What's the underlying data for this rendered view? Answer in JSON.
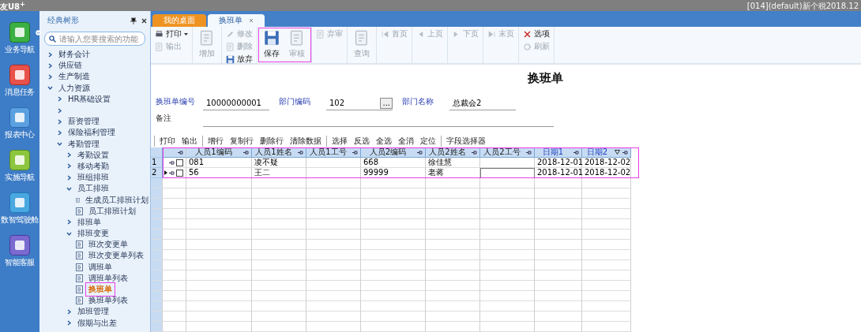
{
  "title_bar": {
    "app_name": "友U8$^{+}$",
    "account": "[014](default)新个税2018.12"
  },
  "nav_strip": [
    {
      "label": "业务导航",
      "menu": true
    },
    {
      "label": "消息任务"
    },
    {
      "label": "报表中心"
    },
    {
      "label": "实施导航"
    },
    {
      "label": "数智驾驶舱"
    },
    {
      "label": "智能客服"
    }
  ],
  "tree_panel": {
    "title": "经典树形",
    "search": {
      "placeholder": "请输入您要搜索的功能"
    },
    "items": [
      {
        "label": "财务会计",
        "kind": "folder",
        "expanded": false,
        "selected": false
      },
      {
        "label": "供应链",
        "kind": "folder",
        "expanded": false,
        "selected": false
      },
      {
        "label": "生产制造",
        "kind": "folder",
        "expanded": false,
        "selected": false
      },
      {
        "label": "人力资源",
        "kind": "folder",
        "expanded": true,
        "selected": false,
        "children": [
          {
            "label": "HR基础设置",
            "kind": "folder",
            "expanded": false,
            "selected": false
          },
          {
            "kind": "folder",
            "expanded": false
          },
          {
            "label": "薪资管理",
            "kind": "folder",
            "expanded": false,
            "selected": false
          },
          {
            "label": "保险福利管理",
            "kind": "folder",
            "expanded": false,
            "selected": false
          },
          {
            "label": "考勤管理",
            "kind": "folder",
            "expanded": true,
            "selected": false,
            "children": [
              {
                "label": "考勤设置",
                "kind": "folder",
                "expanded": false,
                "selected": false
              },
              {
                "label": "移动考勤",
                "kind": "folder",
                "expanded": false,
                "selected": false
              },
              {
                "label": "班组排班",
                "kind": "folder",
                "expanded": false,
                "selected": false
              },
              {
                "label": "员工排班",
                "kind": "folder",
                "expanded": true,
                "selected": false,
                "children": [
                  {
                    "label": "生成员工排班计划",
                    "kind": "leaf",
                    "selected": false
                  },
                  {
                    "label": "员工排班计划",
                    "kind": "leaf",
                    "selected": false
                  }
                ]
              },
              {
                "label": "排班单",
                "kind": "folder",
                "expanded": false,
                "selected": false
              },
              {
                "label": "排班变更",
                "kind": "folder",
                "expanded": true,
                "selected": false,
                "children": [
                  {
                    "label": "班次变更单",
                    "kind": "leaf",
                    "selected": false
                  },
                  {
                    "label": "班次变更单列表",
                    "kind": "leaf",
                    "selected": false
                  },
                  {
                    "label": "调班单",
                    "kind": "leaf",
                    "selected": false
                  },
                  {
                    "label": "调班单列表",
                    "kind": "leaf",
                    "selected": false
                  },
                  {
                    "label": "换班单",
                    "kind": "leaf",
                    "selected": true,
                    "highlighted": true
                  },
                  {
                    "label": "换班单列表",
                    "kind": "leaf",
                    "selected": false
                  }
                ]
              },
              {
                "label": "加班管理",
                "kind": "folder",
                "expanded": false,
                "selected": false
              },
              {
                "label": "假期与出差",
                "kind": "folder",
                "expanded": false,
                "selected": false
              }
            ]
          }
        ]
      }
    ]
  },
  "tabs": [
    {
      "label": "我的桌面",
      "selected": false
    },
    {
      "label": "换班单",
      "selected": true,
      "closable": true
    }
  ],
  "toolbar": [
    {
      "items": [
        {
          "label": "打印",
          "kind": "small",
          "disabled": false,
          "menu": true
        },
        {
          "label": "输出",
          "kind": "small",
          "disabled": true
        }
      ]
    },
    {
      "items": [
        {
          "label": "增加",
          "kind": "large",
          "disabled": true
        }
      ]
    },
    {
      "items": [
        {
          "label": "修改",
          "kind": "small",
          "disabled": true
        },
        {
          "label": "删除",
          "kind": "small",
          "disabled": true
        },
        {
          "label": "放弃",
          "kind": "small",
          "disabled": false
        }
      ]
    },
    {
      "highlighted": true,
      "items": [
        {
          "label": "保存",
          "kind": "large",
          "disabled": false
        },
        {
          "label": "审核",
          "kind": "large",
          "disabled": true
        }
      ]
    },
    {
      "items": [
        {
          "label": "弃审",
          "kind": "small",
          "disabled": true
        }
      ]
    },
    {
      "items": [
        {
          "label": "查询",
          "kind": "large",
          "disabled": true
        }
      ]
    },
    {
      "items": [
        {
          "label": "首页",
          "kind": "small",
          "disabled": true
        }
      ]
    },
    {
      "items": [
        {
          "label": "上页",
          "kind": "small",
          "disabled": true
        }
      ]
    },
    {
      "items": [
        {
          "label": "下页",
          "kind": "small",
          "disabled": true
        }
      ]
    },
    {
      "items": [
        {
          "label": "末页",
          "kind": "small",
          "disabled": true
        }
      ]
    },
    {
      "items": [
        {
          "label": "选项",
          "kind": "small",
          "disabled": false
        },
        {
          "label": "刷新",
          "kind": "small",
          "disabled": true
        }
      ]
    }
  ],
  "document_title": "换班单",
  "form": [
    [
      {
        "label": "换班单编号",
        "value": "10000000001",
        "required": true
      },
      {
        "label": "部门编码",
        "value": "102",
        "required": true,
        "lookup": "..."
      },
      {
        "label": "部门名称",
        "value": "总裁会2",
        "required": true
      }
    ],
    [
      {
        "label": "备注",
        "required": false
      }
    ]
  ],
  "grid_toolbar": [
    [
      "打印",
      "输出"
    ],
    [
      "增行",
      "复制行",
      "删除行",
      "清除数据"
    ],
    [
      "选择",
      "反选",
      "全选",
      "全消",
      "定位"
    ],
    [
      "字段选择器"
    ]
  ],
  "grid": {
    "highlighted": true,
    "columns": [
      {
        "label": "人员1编码",
        "required": false
      },
      {
        "label": "人员1姓名",
        "required": false
      },
      {
        "label": "人员1工号",
        "required": false
      },
      {
        "label": "人员2编码",
        "required": false
      },
      {
        "label": "人员2姓名",
        "required": false
      },
      {
        "label": "人员2工号",
        "required": false
      },
      {
        "label": "日期1",
        "required": true
      },
      {
        "label": "日期2",
        "required": true,
        "filter": true
      }
    ],
    "rows": [
      {
        "number": "1",
        "current": false,
        "checked": false,
        "cells": [
          {
            "text": "081"
          },
          {
            "text": "凌不疑"
          },
          {},
          {
            "text": "668"
          },
          {
            "text": "徐佳慧"
          },
          {},
          {
            "text": "2018-12-01"
          },
          {
            "text": "2018-12-02"
          }
        ]
      },
      {
        "number": "2",
        "current": true,
        "checked": false,
        "cells": [
          {
            "text": "56"
          },
          {
            "text": "王二"
          },
          {},
          {
            "text": "99999"
          },
          {
            "text": "老蒋"
          },
          {
            "editing": true
          },
          {
            "text": "2018-12-01"
          },
          {
            "text": "2018-12-02"
          }
        ]
      }
    ]
  }
}
